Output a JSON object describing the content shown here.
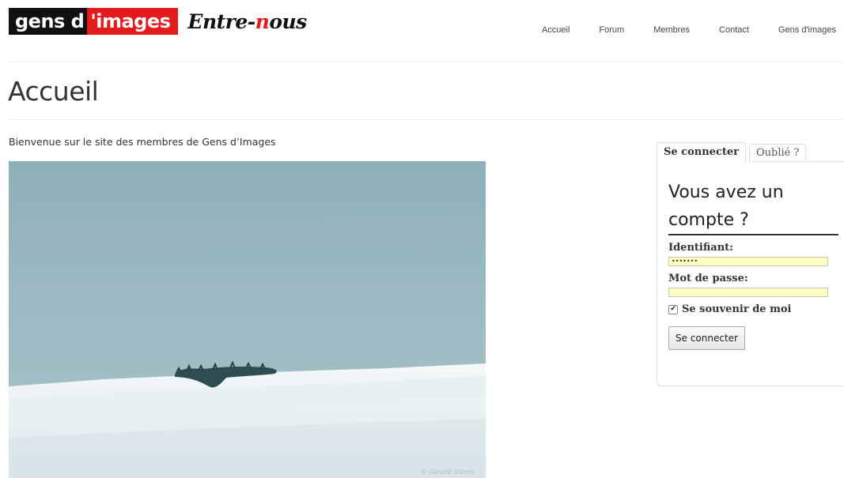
{
  "logo": {
    "part1": "gens d",
    "part2_apos": "'",
    "part2": "images",
    "script_pre": "Entre-",
    "script_accent": "n",
    "script_post": "ous"
  },
  "nav": {
    "items": [
      "Accueil",
      "Forum",
      "Membres",
      "Contact",
      "Gens d'images"
    ]
  },
  "page": {
    "title": "Accueil",
    "intro": "Bienvenue sur le site des membres de Gens d’Images"
  },
  "photo": {
    "credit": "© Gérard Sterns"
  },
  "login": {
    "tab_active": "Se connecter",
    "tab_inactive": "Oublié ?",
    "title": "Vous avez un compte ?",
    "username_label": "Identifiant:",
    "username_value": "•••••••",
    "password_label": "Mot de passe:",
    "password_value": "",
    "remember_label": "Se souvenir de moi",
    "remember_checked": "✔",
    "submit_label": "Se connecter"
  },
  "colors": {
    "brand_red": "#e21b1b",
    "input_bg": "#ffffc4"
  }
}
